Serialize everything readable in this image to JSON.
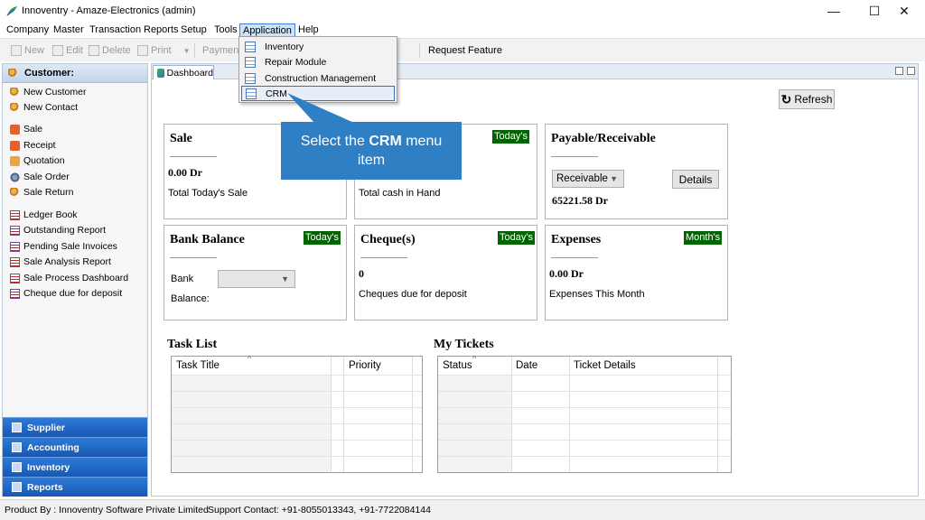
{
  "window": {
    "title": "Innoventry - Amaze-Electronics (admin)",
    "min_glyph": "—",
    "max_glyph": "☐",
    "close_glyph": "✕"
  },
  "menubar": {
    "items": [
      "Company",
      "Master",
      "Transaction",
      "Reports",
      "Setup",
      "Tools",
      "Application",
      "Help"
    ]
  },
  "toolbar": {
    "new": "New",
    "edit": "Edit",
    "delete": "Delete",
    "print": "Print",
    "payment": "Payment",
    "request_feature": "Request Feature"
  },
  "application_menu": {
    "items": [
      "Inventory",
      "Repair Module",
      "Construction Management",
      "CRM"
    ],
    "highlighted": "CRM"
  },
  "sidebar": {
    "header": "Customer:",
    "items": [
      {
        "label": "New Customer",
        "icon": "user-icon"
      },
      {
        "label": "New Contact",
        "icon": "user-icon"
      },
      {
        "label": "Sale",
        "icon": "sale-icon"
      },
      {
        "label": "Receipt",
        "icon": "receipt-icon"
      },
      {
        "label": "Quotation",
        "icon": "quotation-icon"
      },
      {
        "label": "Sale Order",
        "icon": "gear-icon"
      },
      {
        "label": "Sale Return",
        "icon": "user-icon"
      },
      {
        "label": "Ledger Book",
        "icon": "ledger-icon"
      },
      {
        "label": "Outstanding Report",
        "icon": "ledger-icon"
      },
      {
        "label": "Pending Sale Invoices",
        "icon": "ledger-icon"
      },
      {
        "label": "Sale Analysis Report",
        "icon": "ledger-icon"
      },
      {
        "label": "Sale Process Dashboard",
        "icon": "ledger-icon"
      },
      {
        "label": "Cheque due for deposit",
        "icon": "ledger-icon"
      }
    ],
    "sections": [
      "Supplier",
      "Accounting",
      "Inventory",
      "Reports"
    ]
  },
  "tabs": {
    "dashboard": "Dashboard"
  },
  "dashboard": {
    "refresh_label": "Refresh",
    "sale": {
      "title": "Sale",
      "value": "0.00 Dr",
      "label": "Total Today's Sale"
    },
    "cash": {
      "badge": "Today's",
      "label": "Total cash in Hand"
    },
    "payable": {
      "title": "Payable/Receivable",
      "select_value": "Receivable",
      "details_label": "Details",
      "value": "65221.58 Dr"
    },
    "bank": {
      "title": "Bank Balance",
      "badge": "Today's",
      "bank_label": "Bank",
      "balance_label": "Balance:",
      "select_value": ""
    },
    "cheque": {
      "title": "Cheque(s)",
      "badge": "Today's",
      "value": "0",
      "label": "Cheques due for deposit"
    },
    "expenses": {
      "title": "Expenses",
      "badge": "Month's",
      "value": "0.00 Dr",
      "label": "Expenses This Month"
    },
    "task_list": {
      "title": "Task List",
      "columns": [
        "Task Title",
        "Priority"
      ]
    },
    "my_tickets": {
      "title": "My Tickets",
      "columns": [
        "Status",
        "Date",
        "Ticket Details"
      ]
    }
  },
  "callout": {
    "prefix": "Select the ",
    "bold": "CRM",
    "suffix": " menu",
    "line2": "item"
  },
  "statusbar": {
    "product_by": "Product By : Innoventry Software Private Limited",
    "support": "Support Contact: +91-8055013343, +91-7722084144"
  },
  "colors": {
    "badge_green": "#006400",
    "callout_blue": "#2f7fc4",
    "sidebar_section_blue": "#1f66c2"
  }
}
